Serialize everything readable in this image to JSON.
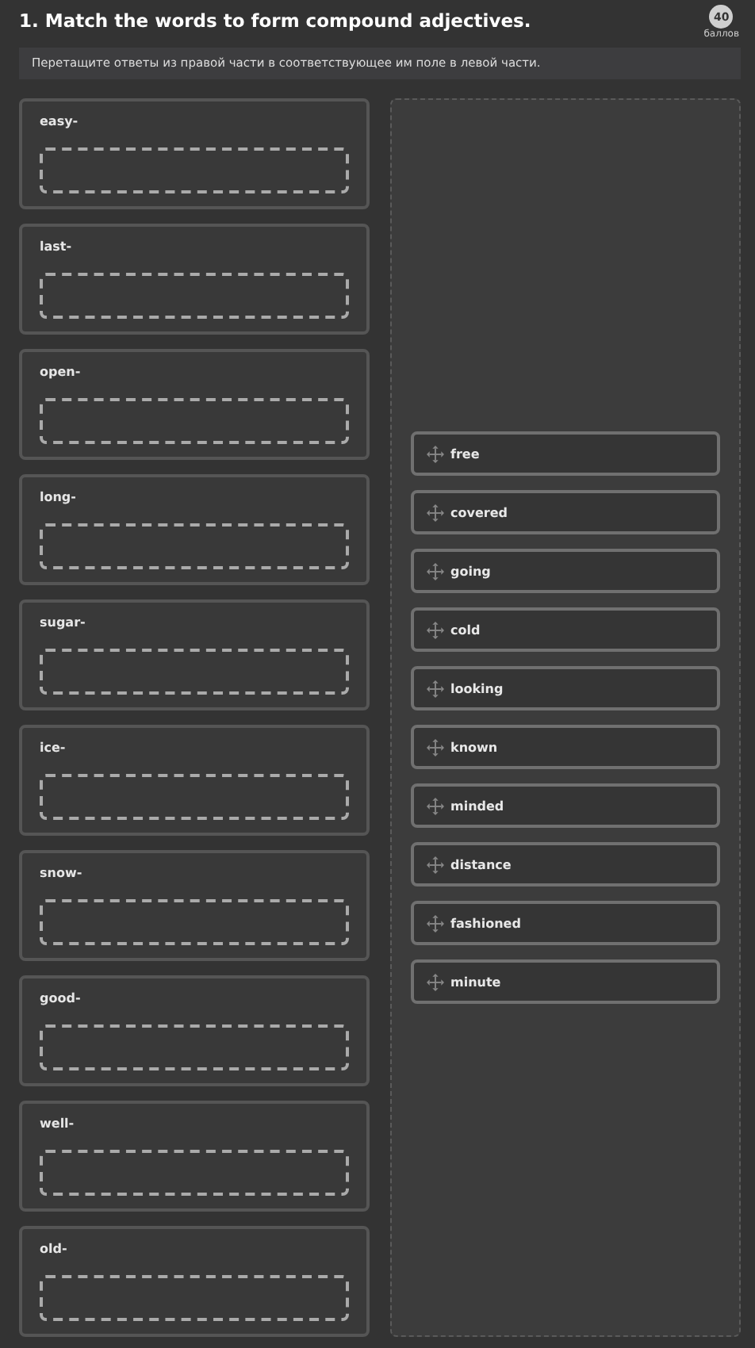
{
  "question": {
    "title": "1. Match the words to form compound adjectives.",
    "points": "40",
    "points_label": "баллов"
  },
  "instruction": "Перетащите ответы из правой части в соответствующее им поле в левой части.",
  "prompts": [
    {
      "label": "easy-"
    },
    {
      "label": "last-"
    },
    {
      "label": "open-"
    },
    {
      "label": "long-"
    },
    {
      "label": "sugar-"
    },
    {
      "label": "ice-"
    },
    {
      "label": "snow-"
    },
    {
      "label": "good-"
    },
    {
      "label": "well-"
    },
    {
      "label": "old-"
    }
  ],
  "answers": [
    {
      "label": "free"
    },
    {
      "label": "covered"
    },
    {
      "label": "going"
    },
    {
      "label": "cold"
    },
    {
      "label": "looking"
    },
    {
      "label": "known"
    },
    {
      "label": "minded"
    },
    {
      "label": "distance"
    },
    {
      "label": "fashioned"
    },
    {
      "label": "minute"
    }
  ]
}
